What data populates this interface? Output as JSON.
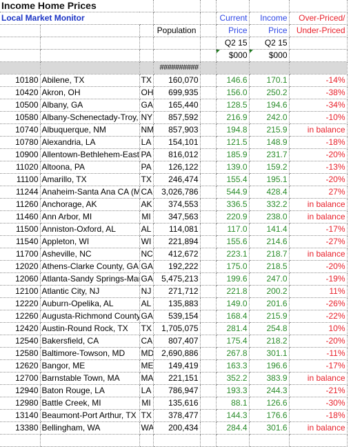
{
  "title": "Income Home Prices",
  "subtitle": "Local Market Monitor",
  "headers": {
    "population": "Population",
    "current_price_line1": "Current",
    "current_price_line2": "Price",
    "current_price_period": "Q2 15",
    "current_price_unit": "$000",
    "income_price_line1": "Income",
    "income_price_line2": "Price",
    "income_price_period": "Q2 15",
    "income_price_unit": "$000",
    "over_under_line1": "Over-Priced/",
    "over_under_line2": "Under-Priced",
    "population_total": "##########"
  },
  "colors": {
    "subtitle": "#1a33c4",
    "price_header": "#2e47e6",
    "over_under": "#e8202a",
    "price_values": "#2a8c2a",
    "band": "#d9d9d9"
  },
  "rows": [
    {
      "code": "10180",
      "metro": "Abilene, TX",
      "state": "TX",
      "population": "160,070",
      "current": "146.6",
      "income": "170.1",
      "status": "-14%"
    },
    {
      "code": "10420",
      "metro": "Akron, OH",
      "state": "OH",
      "population": "699,935",
      "current": "156.0",
      "income": "250.2",
      "status": "-38%"
    },
    {
      "code": "10500",
      "metro": "Albany, GA",
      "state": "GA",
      "population": "165,440",
      "current": "128.5",
      "income": "194.6",
      "status": "-34%"
    },
    {
      "code": "10580",
      "metro": "Albany-Schenectady-Troy, NY",
      "state": "NY",
      "population": "857,592",
      "current": "216.9",
      "income": "242.0",
      "status": "-10%"
    },
    {
      "code": "10740",
      "metro": "Albuquerque, NM",
      "state": "NM",
      "population": "857,903",
      "current": "194.8",
      "income": "215.9",
      "status": "in balance"
    },
    {
      "code": "10780",
      "metro": "Alexandria, LA",
      "state": "LA",
      "population": "154,101",
      "current": "121.5",
      "income": "148.9",
      "status": "-18%"
    },
    {
      "code": "10900",
      "metro": "Allentown-Bethlehem-Easton, PA",
      "state": "PA",
      "population": "816,012",
      "current": "185.9",
      "income": "231.7",
      "status": "-20%"
    },
    {
      "code": "11020",
      "metro": "Altoona, PA",
      "state": "PA",
      "population": "126,122",
      "current": "139.0",
      "income": "159.2",
      "status": "-13%"
    },
    {
      "code": "11100",
      "metro": "Amarillo, TX",
      "state": "TX",
      "population": "246,474",
      "current": "155.4",
      "income": "195.1",
      "status": "-20%"
    },
    {
      "code": "11244",
      "metro": "Anaheim-Santa Ana CA (MD)",
      "state": "CA",
      "population": "3,026,786",
      "current": "544.9",
      "income": "428.4",
      "status": "27%"
    },
    {
      "code": "11260",
      "metro": "Anchorage, AK",
      "state": "AK",
      "population": "374,553",
      "current": "336.5",
      "income": "332.2",
      "status": "in balance"
    },
    {
      "code": "11460",
      "metro": "Ann Arbor, MI",
      "state": "MI",
      "population": "347,563",
      "current": "220.9",
      "income": "238.0",
      "status": "in balance"
    },
    {
      "code": "11500",
      "metro": "Anniston-Oxford, AL",
      "state": "AL",
      "population": "114,081",
      "current": "117.0",
      "income": "141.4",
      "status": "-17%"
    },
    {
      "code": "11540",
      "metro": "Appleton, WI",
      "state": "WI",
      "population": "221,894",
      "current": "155.6",
      "income": "214.6",
      "status": "-27%"
    },
    {
      "code": "11700",
      "metro": "Asheville, NC",
      "state": "NC",
      "population": "412,672",
      "current": "223.1",
      "income": "218.7",
      "status": "in balance"
    },
    {
      "code": "12020",
      "metro": "Athens-Clarke County, GA",
      "state": "GA",
      "population": "192,222",
      "current": "175.0",
      "income": "218.5",
      "status": "-20%"
    },
    {
      "code": "12060",
      "metro": "Atlanta-Sandy Springs-Marietta, GA",
      "state": "GA",
      "population": "5,475,213",
      "current": "199.6",
      "income": "247.0",
      "status": "-19%"
    },
    {
      "code": "12100",
      "metro": "Atlantic City, NJ",
      "state": "NJ",
      "population": "271,712",
      "current": "221.8",
      "income": "200.2",
      "status": "11%"
    },
    {
      "code": "12220",
      "metro": "Auburn-Opelika, AL",
      "state": "AL",
      "population": "135,883",
      "current": "149.0",
      "income": "201.6",
      "status": "-26%"
    },
    {
      "code": "12260",
      "metro": "Augusta-Richmond County, GA",
      "state": "GA",
      "population": "539,154",
      "current": "168.4",
      "income": "215.9",
      "status": "-22%"
    },
    {
      "code": "12420",
      "metro": "Austin-Round Rock, TX",
      "state": "TX",
      "population": "1,705,075",
      "current": "281.4",
      "income": "254.8",
      "status": "10%"
    },
    {
      "code": "12540",
      "metro": "Bakersfield, CA",
      "state": "CA",
      "population": "807,407",
      "current": "175.4",
      "income": "218.2",
      "status": "-20%"
    },
    {
      "code": "12580",
      "metro": "Baltimore-Towson, MD",
      "state": "MD",
      "population": "2,690,886",
      "current": "267.8",
      "income": "301.1",
      "status": "-11%"
    },
    {
      "code": "12620",
      "metro": "Bangor, ME",
      "state": "ME",
      "population": "149,419",
      "current": "163.3",
      "income": "196.6",
      "status": "-17%"
    },
    {
      "code": "12700",
      "metro": "Barnstable Town, MA",
      "state": "MA",
      "population": "221,151",
      "current": "352.2",
      "income": "383.9",
      "status": "in balance"
    },
    {
      "code": "12940",
      "metro": "Baton Rouge, LA",
      "state": "LA",
      "population": "786,947",
      "current": "193.3",
      "income": "244.3",
      "status": "-21%"
    },
    {
      "code": "12980",
      "metro": "Battle Creek, MI",
      "state": "MI",
      "population": "135,616",
      "current": "88.1",
      "income": "126.6",
      "status": "-30%"
    },
    {
      "code": "13140",
      "metro": "Beaumont-Port Arthur, TX",
      "state": "TX",
      "population": "378,477",
      "current": "144.3",
      "income": "176.6",
      "status": "-18%"
    },
    {
      "code": "13380",
      "metro": "Bellingham, WA",
      "state": "WA",
      "population": "200,434",
      "current": "284.4",
      "income": "301.6",
      "status": "in balance"
    }
  ]
}
